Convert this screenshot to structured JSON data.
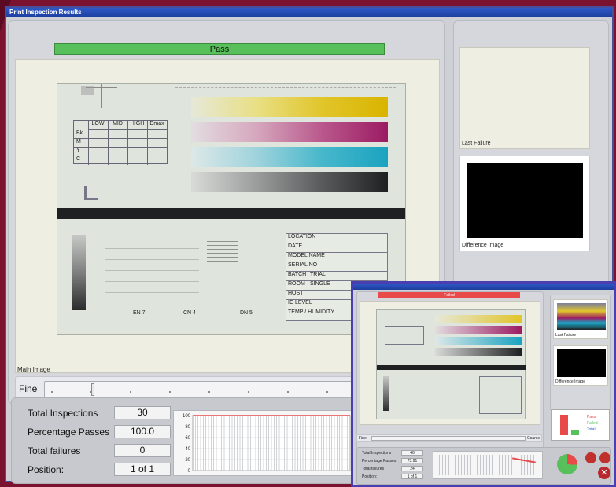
{
  "window": {
    "title": "Print Inspection Results"
  },
  "status": {
    "label": "Pass"
  },
  "main_image": {
    "label": "Main Image",
    "table_headers": [
      "LOW",
      "MID",
      "HIGH",
      "Dmax"
    ],
    "table_rows": [
      "Bk",
      "M",
      "Y",
      "C"
    ],
    "form_fields": [
      "LOCATION",
      "DATE",
      "MODEL NAME",
      "SERIAL NO",
      "BATCH",
      "ROOM",
      "HOST",
      "IC LEVEL",
      "TEMP / HUMIDITY"
    ],
    "batch_value": "TRIAL",
    "room_value": "SINGLE",
    "captions": [
      "EN 7",
      "CN 4",
      "DN 5"
    ]
  },
  "fine_control": {
    "label": "Fine",
    "level": 0.12
  },
  "side_panel": {
    "last_failure_label": "Last Failure",
    "difference_label": "Difference Image"
  },
  "stats": {
    "total_inspections_label": "Total Inspections",
    "total_inspections": "30",
    "percentage_passes_label": "Percentage Passes",
    "percentage_passes": "100.0",
    "total_failures_label": "Total failures",
    "total_failures": "0",
    "position_label": "Position:",
    "position": "1 of 1"
  },
  "chart_data": {
    "type": "line",
    "y_ticks": [
      "100",
      "80",
      "60",
      "40",
      "20",
      "0"
    ],
    "ylim": [
      0,
      100
    ],
    "series": [
      {
        "values": [
          100,
          100,
          100,
          100,
          100,
          100,
          100,
          100,
          100,
          100,
          100,
          100,
          100,
          100,
          100,
          100,
          100,
          100,
          100,
          100,
          100,
          100,
          100,
          100,
          100,
          100,
          100,
          100,
          100,
          100
        ]
      }
    ]
  },
  "inset": {
    "status": "Failed",
    "fine_label": "Fine",
    "coarse_label": "Coarse",
    "last_failure_label": "Last Failure",
    "difference_label": "Difference Image",
    "stats": {
      "total_inspections_label": "Total Inspections",
      "total_inspections": "46",
      "percentage_passes_label": "Percentage Passes",
      "percentage_passes": "73.91",
      "total_failures_label": "Total failures",
      "total_failures": "24",
      "position_label": "Position:",
      "position": "1 of 1"
    },
    "legend": [
      "Pass",
      "Failed",
      "Total"
    ]
  },
  "colors": {
    "pass": "#58c05a",
    "fail": "#e84a4a",
    "accent": "#2f58c8"
  }
}
